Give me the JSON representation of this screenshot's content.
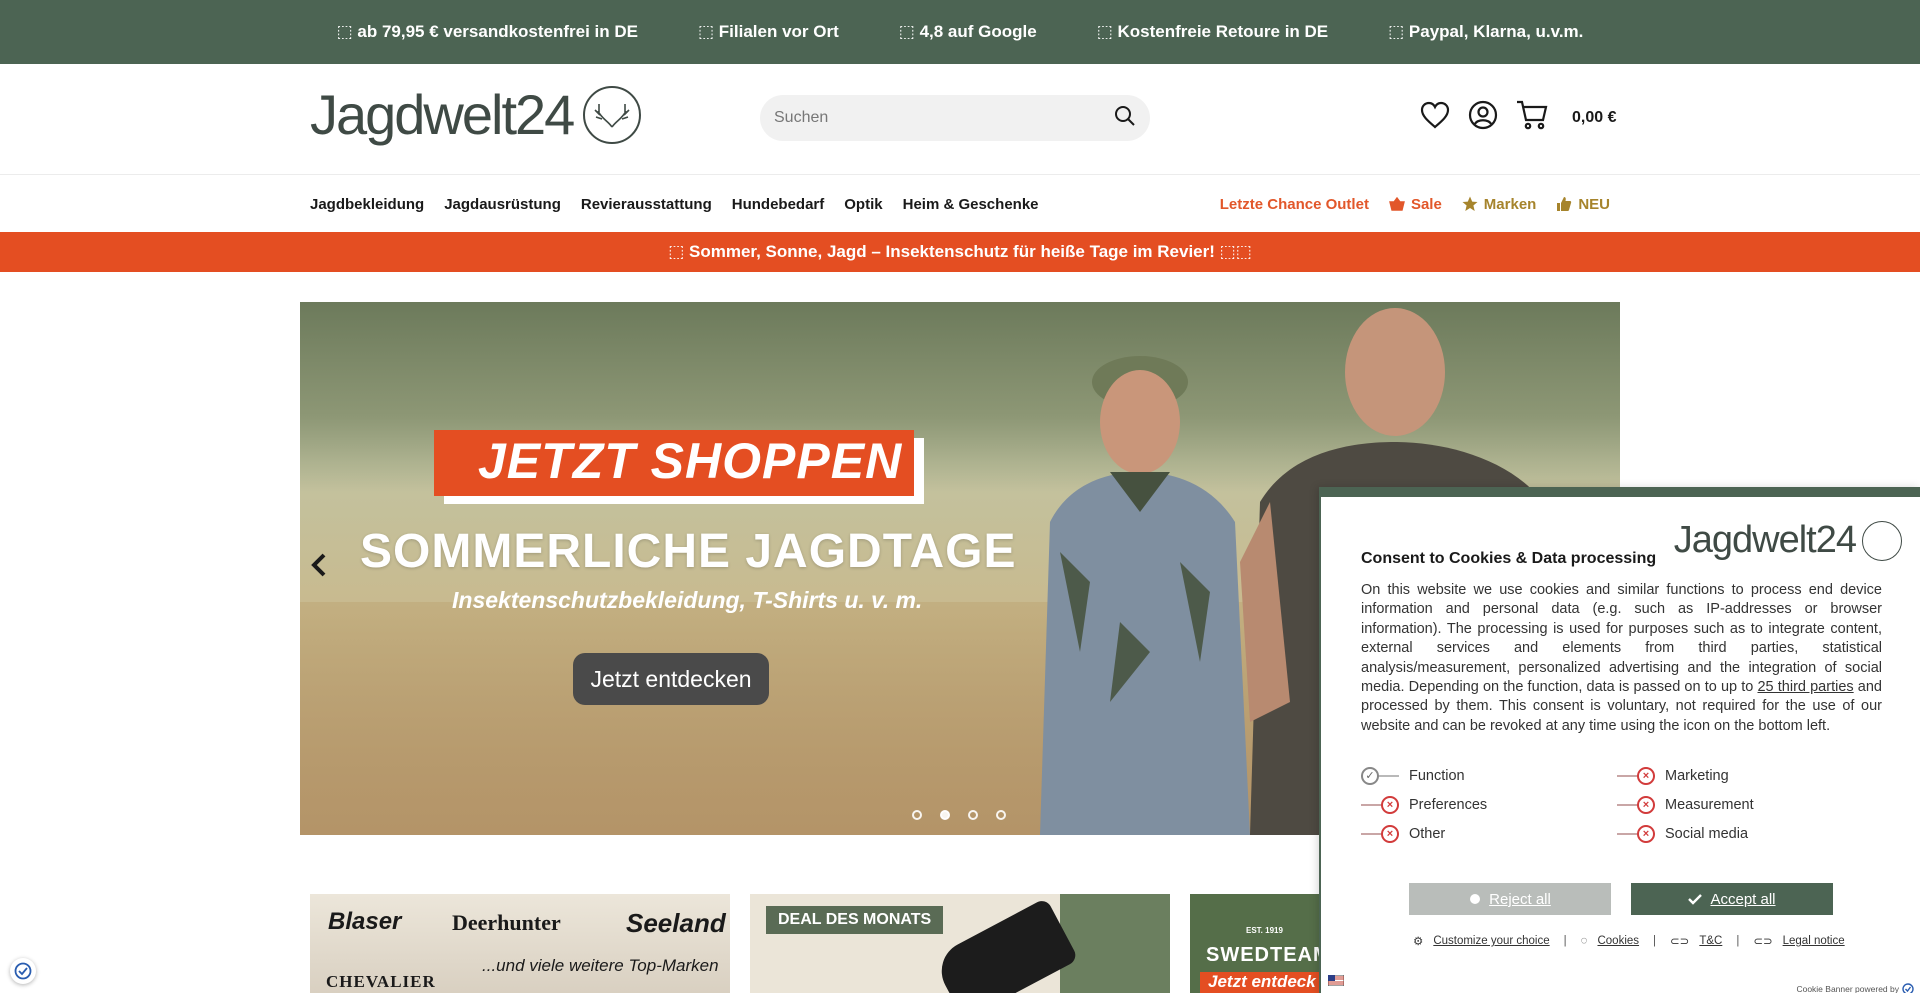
{
  "topbar": {
    "items": [
      "⬚ ab 79,95 € versandkostenfrei in DE",
      "⬚ Filialen vor Ort",
      "⬚ 4,8 auf Google",
      "⬚ Kostenfreie Retoure in DE",
      "⬚ Paypal, Klarna, u.v.m."
    ],
    "background": "#4c6453"
  },
  "header": {
    "logo_text": "Jagdwelt24",
    "search_placeholder": "Suchen",
    "cart_total": "0,00 €",
    "icons": [
      "heart-icon",
      "account-icon",
      "cart-icon",
      "search-icon",
      "antler-logo-icon"
    ]
  },
  "nav": {
    "left": [
      "Jagdbekleidung",
      "Jagdausrüstung",
      "Revierausstattung",
      "Hundebedarf",
      "Optik",
      "Heim & Geschenke"
    ],
    "outlet": "Letzte Chance Outlet",
    "sale": "Sale",
    "brands": "Marken",
    "new": "NEU",
    "colors": {
      "outlet": "#e2572a",
      "gold": "#a6842c"
    }
  },
  "promo": {
    "text": "⬚ Sommer, Sonne, Jagd – Insektenschutz für heiße Tage im Revier! ⬚⬚",
    "background": "#e44e22"
  },
  "hero": {
    "banner": "JETZT SHOPPEN",
    "title": "SOMMERLICHE JAGDTAGE",
    "subtitle": "Insektenschutzbekleidung, T-Shirts u. v. m.",
    "button": "Jetzt entdecken",
    "slides": 4,
    "active_slide": 1
  },
  "tiles": {
    "brands": {
      "blaser": "Blaser",
      "deerhunter": "Deerhunter",
      "seeland": "Seeland",
      "chevalier": "CHEVALIER",
      "more": "...und viele weitere Top-Marken"
    },
    "deal": {
      "tag": "DEAL DES MONATS"
    },
    "swedteam": {
      "name": "SWEDTEAM",
      "est": "EST. 1919",
      "cta": "Jetzt entdeck"
    }
  },
  "cookie": {
    "logo_text": "Jagdwelt24",
    "title": "Consent to Cookies & Data processing",
    "body_pre": "On this website we use cookies and similar functions to process end device information and personal data (e.g. such as IP-addresses or browser information). The processing is used for purposes such as to integrate content, external services and elements from third parties, statistical analysis/measurement, personalized advertising and the integration of social media. Depending on the function, data is passed on to up to ",
    "body_link": "25 third parties",
    "body_post": " and processed by them. This consent is voluntary, not required for the use of our website and can be revoked at any time using the icon on the bottom left.",
    "toggles": [
      {
        "label": "Function",
        "on": true
      },
      {
        "label": "Marketing",
        "on": false
      },
      {
        "label": "Preferences",
        "on": false
      },
      {
        "label": "Measurement",
        "on": false
      },
      {
        "label": "Other",
        "on": false
      },
      {
        "label": "Social media",
        "on": false
      }
    ],
    "reject": "Reject all",
    "accept": "Accept all",
    "links": {
      "customize": "Customize your choice",
      "cookies": "Cookies",
      "tc": "T&C",
      "legal": "Legal notice"
    },
    "powered": "Cookie Banner powered by",
    "colors": {
      "accent": "#4c6453",
      "reject_bg": "#b9bdba",
      "toggle_off": "#d23b3b"
    }
  }
}
